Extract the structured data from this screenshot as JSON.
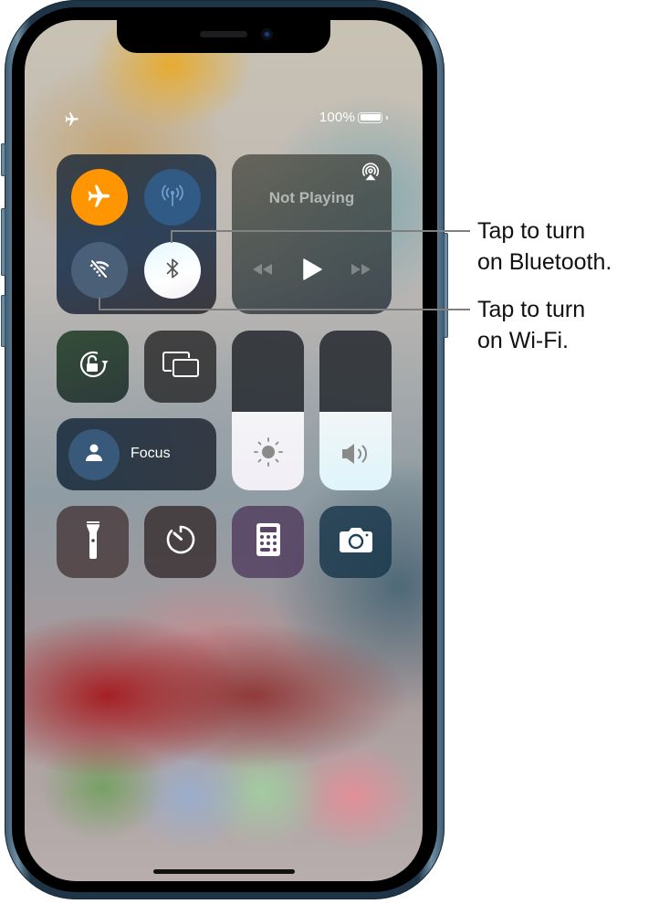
{
  "device": "iPhone",
  "status_bar": {
    "left_icon": "airplane-mode-icon",
    "battery_percent_label": "100%",
    "battery_level": 1.0
  },
  "control_center": {
    "connectivity": {
      "airplane_mode": {
        "icon": "airplane-icon",
        "state": "on",
        "color": "#ff9500"
      },
      "cellular_data": {
        "icon": "antenna-icon",
        "state": "disabled"
      },
      "wifi": {
        "icon": "wifi-off-icon",
        "state": "off"
      },
      "bluetooth": {
        "icon": "bluetooth-icon",
        "state": "off-highlighted"
      }
    },
    "media": {
      "title": "Not Playing",
      "airplay_icon": "airplay-icon",
      "controls": [
        "rewind-icon",
        "play-icon",
        "fast-forward-icon"
      ]
    },
    "orientation_lock": {
      "icon": "rotation-lock-icon"
    },
    "screen_mirroring": {
      "icon": "screen-mirroring-icon"
    },
    "focus": {
      "label": "Focus",
      "icon": "person-icon"
    },
    "brightness": {
      "icon": "sun-icon",
      "level_percent": 49
    },
    "volume": {
      "icon": "speaker-icon",
      "level_percent": 49
    },
    "shortcuts": [
      {
        "name": "flashlight",
        "icon": "flashlight-icon"
      },
      {
        "name": "timer",
        "icon": "timer-icon"
      },
      {
        "name": "calculator",
        "icon": "calculator-icon"
      },
      {
        "name": "camera",
        "icon": "camera-icon"
      }
    ]
  },
  "callouts": {
    "bluetooth": {
      "line1": "Tap to turn",
      "line2": "on Bluetooth."
    },
    "wifi": {
      "line1": "Tap to turn",
      "line2": "on Wi-Fi."
    }
  },
  "colors": {
    "airplane_active": "#ff9500",
    "cellular_inactive": "#2f5f8e",
    "wifi_inactive": "#4e6478",
    "bluetooth_highlight": "#f2fbff",
    "slider_fill": "#f0f3f6",
    "callout_line": "#808080"
  }
}
